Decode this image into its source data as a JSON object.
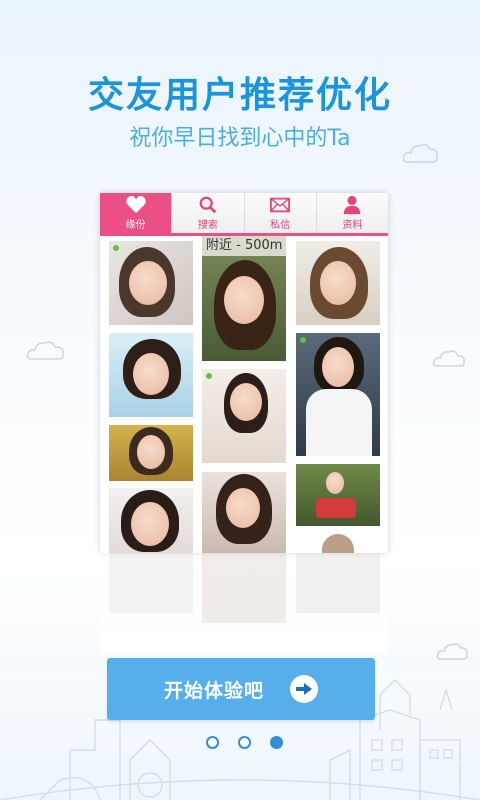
{
  "header": {
    "title": "交友用户推荐优化",
    "subtitle": "祝你早日找到心中的Ta"
  },
  "app_preview": {
    "tabs": [
      {
        "label": "缘份",
        "icon": "heart-icon",
        "active": true
      },
      {
        "label": "搜索",
        "icon": "search-icon",
        "active": false
      },
      {
        "label": "私信",
        "icon": "mail-icon",
        "active": false
      },
      {
        "label": "资料",
        "icon": "profile-icon",
        "active": false
      }
    ],
    "nearby_label": "附近 - 500m"
  },
  "start_button": {
    "label": "开始体验吧",
    "icon": "arrow-right-icon"
  },
  "pager": {
    "count": 3,
    "active_index": 2
  },
  "colors": {
    "accent_blue": "#1a95dc",
    "tab_pink": "#ec4f86",
    "button_blue": "#56aeea"
  }
}
